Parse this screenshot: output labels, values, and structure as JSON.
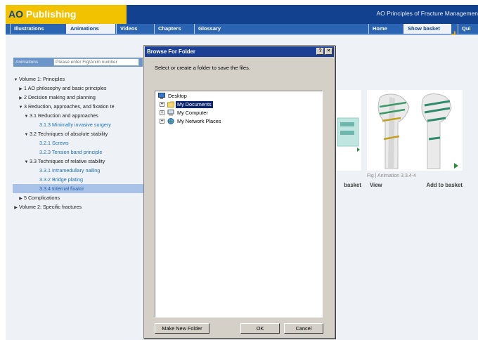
{
  "header": {
    "logo_prefix": "AO",
    "logo_name": "Publishing",
    "app_title": "AO Principles of Fracture Managemen"
  },
  "nav": {
    "items": [
      "Illustrations",
      "Animations",
      "Videos",
      "Chapters",
      "Glossary",
      "Home",
      "Show basket",
      "Qui"
    ],
    "active": "Animations"
  },
  "search": {
    "label": "Animations",
    "placeholder": "Please enter Fig/Anim number"
  },
  "tree": {
    "items": [
      {
        "arrow": "▼",
        "label": "Volume 1: Principles",
        "level": 0
      },
      {
        "arrow": "▶",
        "label": "1 AO philosophy and basic principles",
        "level": 1
      },
      {
        "arrow": "▶",
        "label": "2 Decision making and planning",
        "level": 1
      },
      {
        "arrow": "▼",
        "label": "3 Reduction, approaches, and fixation te",
        "level": 1
      },
      {
        "arrow": "▼",
        "label": "3.1 Reduction and approaches",
        "level": 2
      },
      {
        "arrow": "",
        "label": "3.1.3 Minimally invasive surgery",
        "level": 3
      },
      {
        "arrow": "▼",
        "label": "3.2 Techniques of absolute stability",
        "level": 2
      },
      {
        "arrow": "",
        "label": "3.2.1 Screws",
        "level": 3
      },
      {
        "arrow": "",
        "label": "3.2.3 Tension band principle",
        "level": 3
      },
      {
        "arrow": "▼",
        "label": "3.3 Techniques of relative stability",
        "level": 2
      },
      {
        "arrow": "",
        "label": "3.3.1 Intramedullary nailing",
        "level": 3
      },
      {
        "arrow": "",
        "label": "3.3.2 Bridge plating",
        "level": 3
      },
      {
        "arrow": "",
        "label": "3.3.4 Internal fixator",
        "level": 3
      },
      {
        "arrow": "▶",
        "label": "5 Complications",
        "level": 1
      },
      {
        "arrow": "▶",
        "label": "Volume 2: Specific fractures",
        "level": 0
      }
    ],
    "selected_label": "3.3.4 Internal fixator"
  },
  "cards": {
    "left": {
      "caption": "3",
      "add_label": "basket"
    },
    "right": {
      "caption": "Fig | Animation 3.3.4-4",
      "view_label": "View",
      "add_label": "Add to basket"
    }
  },
  "dialog": {
    "title": "Browse For Folder",
    "help_button": "?",
    "close_button": "×",
    "instruction": "Select or create a folder to save the files.",
    "folders": [
      {
        "label": "Desktop",
        "icon": "desktop-icon",
        "expander": ""
      },
      {
        "label": "My Documents",
        "icon": "folder-icon",
        "expander": "+"
      },
      {
        "label": "My Computer",
        "icon": "computer-icon",
        "expander": "+"
      },
      {
        "label": "My Network Places",
        "icon": "network-icon",
        "expander": "+"
      }
    ],
    "selected_folder": "My Documents",
    "buttons": {
      "new_folder": "Make New Folder",
      "ok": "OK",
      "cancel": "Cancel"
    }
  },
  "colors": {
    "header_blue": "#12418f",
    "logo_yellow": "#f2c200",
    "nav_blue": "#2c64b4",
    "selection_blue": "#0b246a",
    "tree_selected_bg": "#a9c3e8",
    "dialog_gray": "#d4d0c8"
  }
}
